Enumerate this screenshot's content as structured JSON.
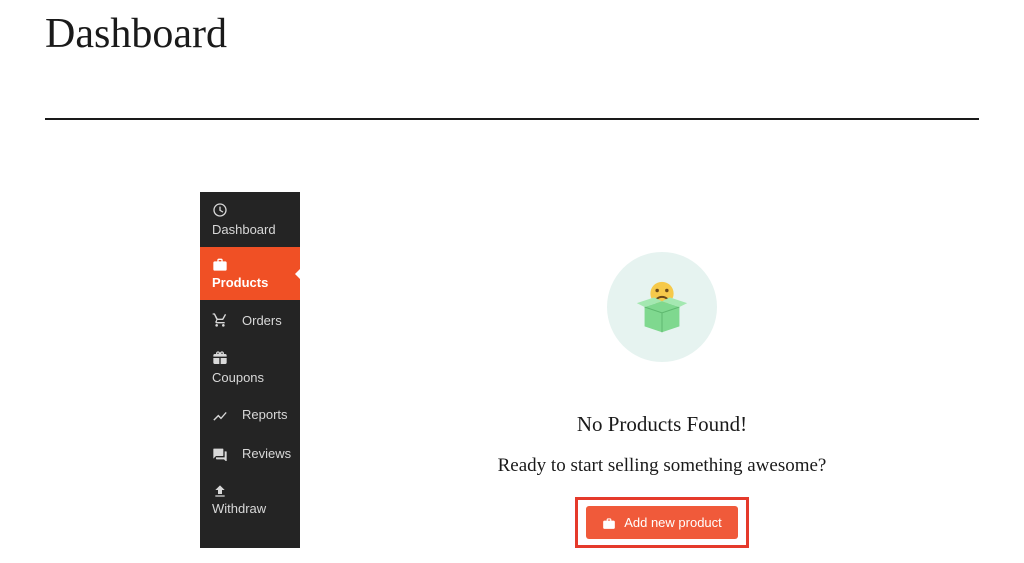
{
  "header": {
    "title": "Dashboard"
  },
  "sidebar": {
    "items": [
      {
        "label": "Dashboard",
        "icon": "dashboard"
      },
      {
        "label": "Products",
        "icon": "briefcase",
        "active": true
      },
      {
        "label": "Orders",
        "icon": "cart"
      },
      {
        "label": "Coupons",
        "icon": "gift"
      },
      {
        "label": "Reports",
        "icon": "chart"
      },
      {
        "label": "Reviews",
        "icon": "comments"
      },
      {
        "label": "Withdraw",
        "icon": "upload"
      }
    ]
  },
  "main": {
    "empty_title": "No Products Found!",
    "empty_subtitle": "Ready to start selling something awesome?",
    "add_button_label": "Add new product"
  }
}
